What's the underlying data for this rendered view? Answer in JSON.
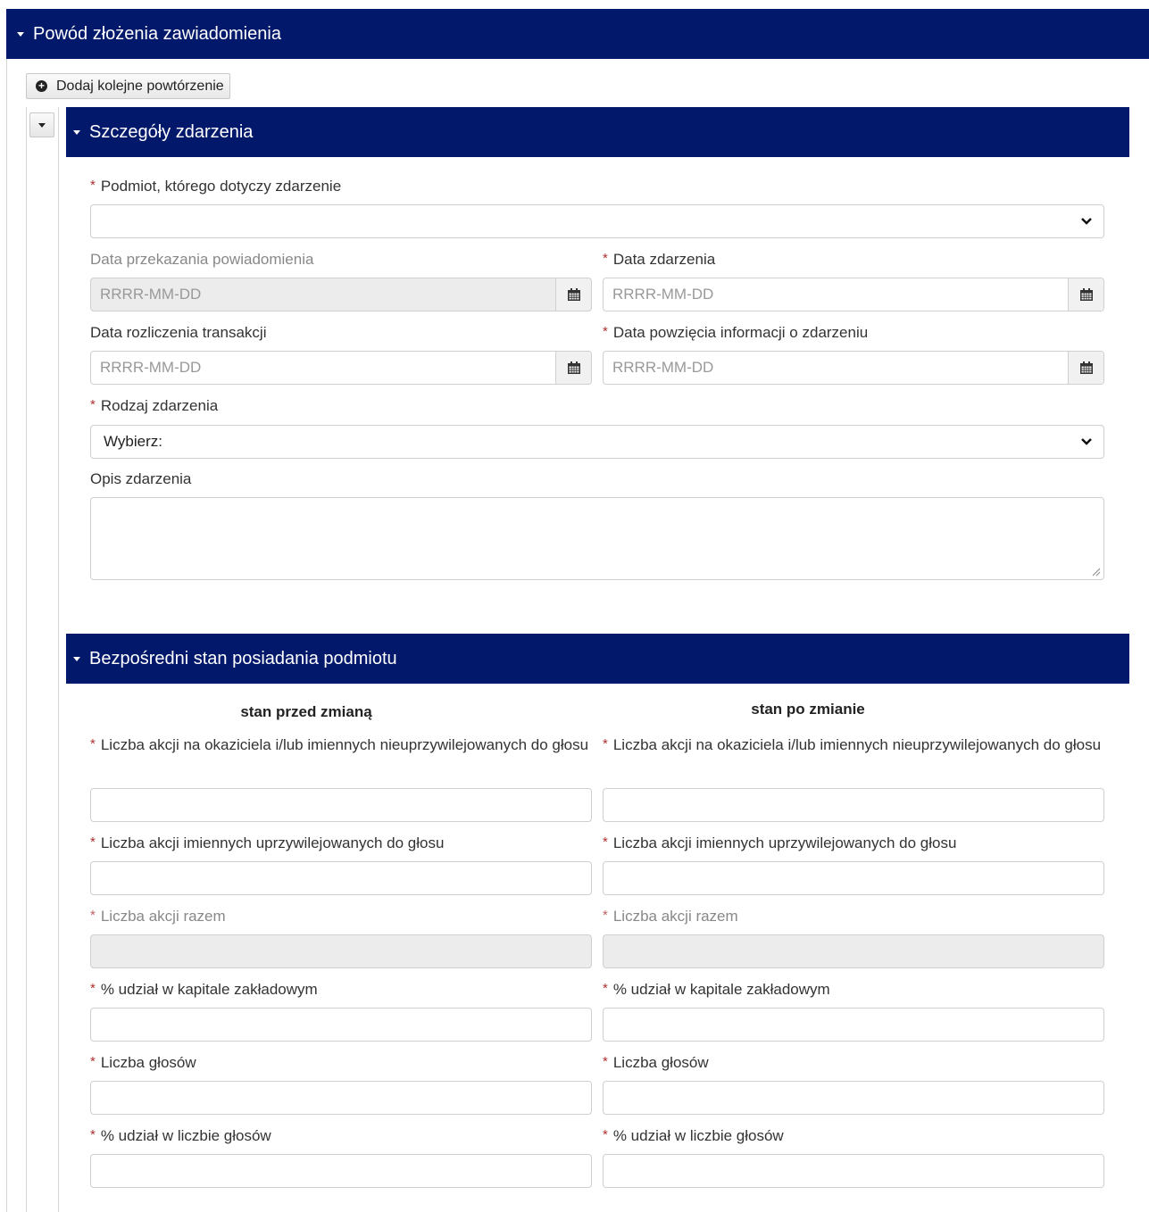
{
  "main_section": {
    "title": "Powód złożenia zawiadomienia"
  },
  "add_button": {
    "label": "Dodaj kolejne powtórzenie"
  },
  "details": {
    "title": "Szczegóły zdarzenia",
    "subject": {
      "label": "Podmiot, którego dotyczy zdarzenie",
      "value": ""
    },
    "notification_date": {
      "label": "Data przekazania powiadomienia",
      "placeholder": "RRRR-MM-DD"
    },
    "event_date": {
      "label": "Data zdarzenia",
      "placeholder": "RRRR-MM-DD"
    },
    "settlement_date": {
      "label": "Data rozliczenia transakcji",
      "placeholder": "RRRR-MM-DD"
    },
    "info_date": {
      "label": "Data powzięcia informacji o zdarzeniu",
      "placeholder": "RRRR-MM-DD"
    },
    "event_type": {
      "label": "Rodzaj zdarzenia",
      "value": "Wybierz:"
    },
    "description": {
      "label": "Opis zdarzenia",
      "value": ""
    }
  },
  "holdings": {
    "title": "Bezpośredni stan posiadania podmiotu",
    "before_title": "stan przed zmianą",
    "after_title": "stan po zmianie",
    "fields": {
      "bearer_shares": "Liczba akcji na okaziciela i/lub imiennych nieuprzywilejowanych do głosu",
      "preferred_shares": "Liczba akcji imiennych uprzywilejowanych do głosu",
      "total_shares": "Liczba akcji razem",
      "capital_share": "% udział w kapitale zakładowym",
      "votes": "Liczba głosów",
      "votes_share": "% udział w liczbie głosów"
    }
  },
  "colors": {
    "header_bg": "#02186b",
    "required": "#b03030"
  }
}
